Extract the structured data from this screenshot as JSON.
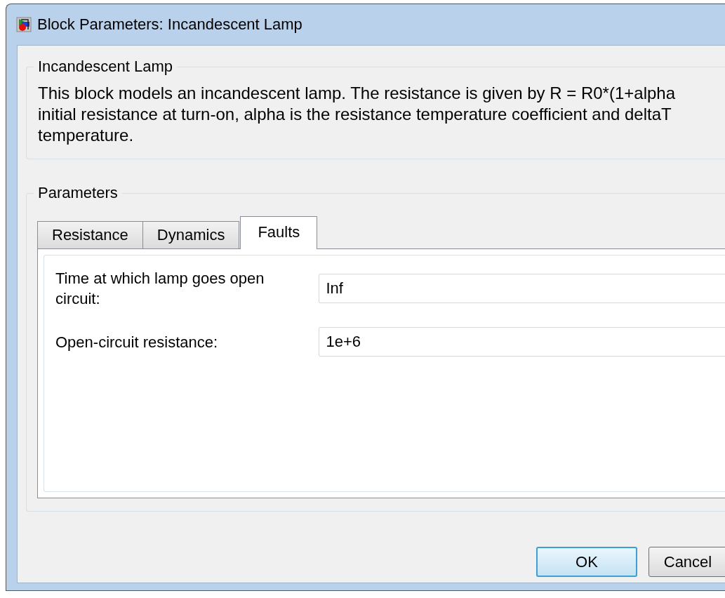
{
  "window": {
    "title": "Block Parameters: Incandescent Lamp"
  },
  "description": {
    "title": "Incandescent Lamp",
    "lines": [
      "This block models an incandescent lamp. The resistance is given by R = R0*(1+alpha",
      "initial resistance at turn-on, alpha is the resistance temperature coefficient and deltaT",
      "temperature."
    ]
  },
  "parameters": {
    "title": "Parameters",
    "tabs": [
      {
        "label": "Resistance",
        "selected": false
      },
      {
        "label": "Dynamics",
        "selected": false
      },
      {
        "label": "Faults",
        "selected": true
      }
    ],
    "fields": [
      {
        "label": "Time at which lamp goes open circuit:",
        "value": "Inf"
      },
      {
        "label": "Open-circuit resistance:",
        "value": "1e+6"
      }
    ]
  },
  "buttons": [
    {
      "label": "OK",
      "default": true
    },
    {
      "label": "Cancel",
      "default": false
    }
  ]
}
